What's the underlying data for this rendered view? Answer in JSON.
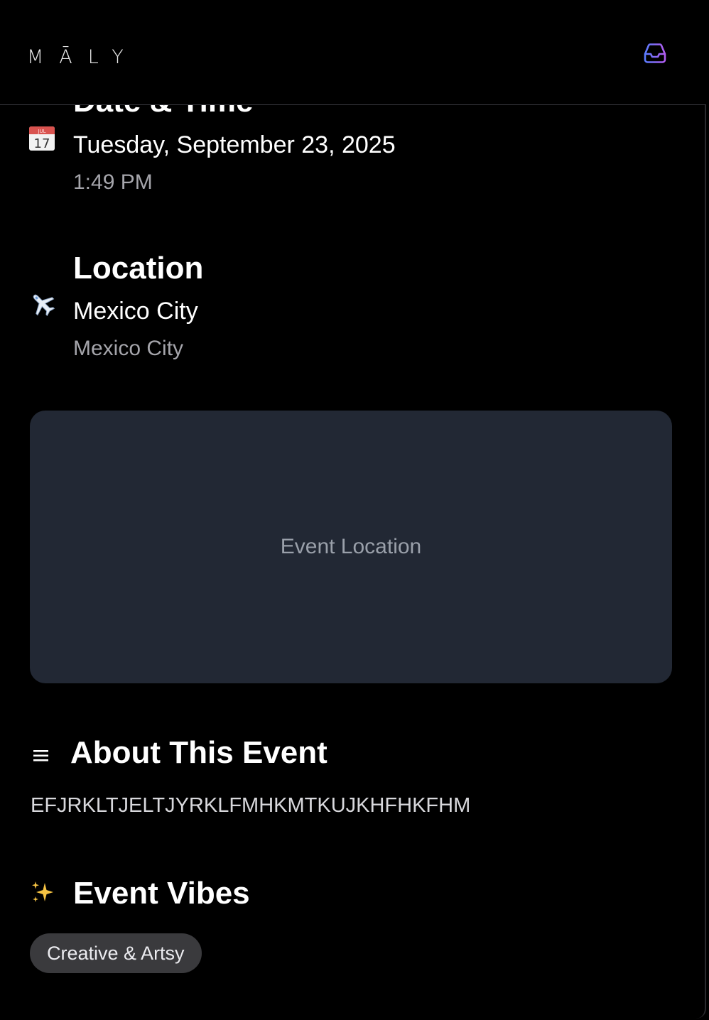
{
  "header": {
    "logo": "MĀLY",
    "inbox_icon": "inbox-tray-icon",
    "accent_colors": [
      "#5b7cff",
      "#b25cf0"
    ]
  },
  "date_time": {
    "heading": "Date & Time",
    "icon": "calendar-icon",
    "calendar_icon_month": "JUL",
    "calendar_icon_day": "17",
    "date": "Tuesday, September 23, 2025",
    "time": "1:49 PM"
  },
  "location": {
    "heading": "Location",
    "icon": "airplane-icon",
    "name": "Mexico City",
    "detail": "Mexico City",
    "map_placeholder": "Event Location"
  },
  "about": {
    "icon": "menu-lines-icon",
    "heading": "About This Event",
    "text": "EFJRKLTJELTJYRKLFMHKMTKUJKHFHKFHM"
  },
  "vibes": {
    "icon": "sparkles-icon",
    "heading": "Event Vibes",
    "tags": [
      "Creative & Artsy"
    ]
  }
}
